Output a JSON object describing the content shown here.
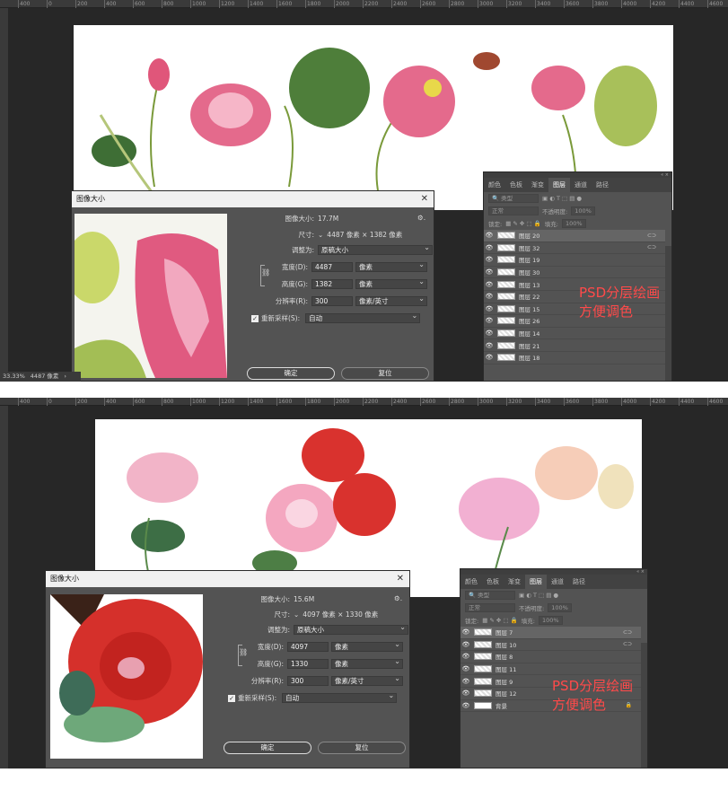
{
  "shots": [
    {
      "ruler_ticks": [
        "400",
        "0",
        "200",
        "400",
        "600",
        "800",
        "1000",
        "1200",
        "1400",
        "1600",
        "1800",
        "2000",
        "2200",
        "2400",
        "2600",
        "2800",
        "3000",
        "3200",
        "3400",
        "3600",
        "3800",
        "4000",
        "4200",
        "4400",
        "4600"
      ],
      "status": {
        "zoom": "33.33%",
        "size": "4487 像素",
        "arrow": "›"
      },
      "dialog": {
        "title": "图像大小",
        "close": "✕",
        "image_size_label": "图像大小:",
        "image_size_value": "17.7M",
        "gear": "⚙.",
        "dimensions_label": "尺寸:",
        "dimensions_value": "4487 像素  ×  1382 像素",
        "fit_label": "调整为:",
        "fit_value": "原稿大小",
        "width_label": "宽度(D):",
        "width_value": "4487",
        "width_unit": "像素",
        "height_label": "高度(G):",
        "height_value": "1382",
        "height_unit": "像素",
        "resolution_label": "分辨率(R):",
        "resolution_value": "300",
        "resolution_unit": "像素/英寸",
        "resample_label": "重新采样(S):",
        "resample_value": "自动",
        "ok": "确定",
        "reset": "复位"
      },
      "panel": {
        "collapse": "« ×",
        "tabs": [
          "颜色",
          "色板",
          "渐变",
          "图层",
          "通道",
          "路径"
        ],
        "active_tab": "图层",
        "filter_placeholder": "类型",
        "blend_mode": "正常",
        "opacity_label": "不透明度:",
        "opacity_value": "100%",
        "lock_label": "锁定:",
        "fill_label": "填充:",
        "fill_value": "100%",
        "layers": [
          "图层 20",
          "图层 32",
          "图层 19",
          "图层 30",
          "图层 13",
          "图层 22",
          "图层 15",
          "图层 26",
          "图层 14",
          "图层 21",
          "图层 18"
        ]
      },
      "overlay": [
        "PSD分层绘画",
        "方便调色"
      ]
    },
    {
      "ruler_ticks": [
        "400",
        "0",
        "200",
        "400",
        "600",
        "800",
        "1000",
        "1200",
        "1400",
        "1600",
        "1800",
        "2000",
        "2200",
        "2400",
        "2600",
        "2800",
        "3000",
        "3200",
        "3400",
        "3600",
        "3800",
        "4000",
        "4200",
        "4400",
        "4600"
      ],
      "dialog": {
        "title": "图像大小",
        "close": "✕",
        "image_size_label": "图像大小:",
        "image_size_value": "15.6M",
        "gear": "⚙.",
        "dimensions_label": "尺寸:",
        "dimensions_value": "4097 像素  ×  1330 像素",
        "fit_label": "调整为:",
        "fit_value": "原稿大小",
        "width_label": "宽度(D):",
        "width_value": "4097",
        "width_unit": "像素",
        "height_label": "高度(G):",
        "height_value": "1330",
        "height_unit": "像素",
        "resolution_label": "分辨率(R):",
        "resolution_value": "300",
        "resolution_unit": "像素/英寸",
        "resample_label": "重新采样(S):",
        "resample_value": "自动",
        "ok": "确定",
        "reset": "复位"
      },
      "panel": {
        "collapse": "« ×",
        "tabs": [
          "颜色",
          "色板",
          "渐变",
          "图层",
          "通道",
          "路径"
        ],
        "active_tab": "图层",
        "filter_placeholder": "类型",
        "blend_mode": "正常",
        "opacity_label": "不透明度:",
        "opacity_value": "100%",
        "lock_label": "锁定:",
        "fill_label": "填充:",
        "fill_value": "100%",
        "layers": [
          "图层 7",
          "图层 10",
          "图层 8",
          "图层 11",
          "图层 9",
          "图层 12",
          "背景"
        ]
      },
      "overlay": [
        "PSD分层绘画",
        "方便调色"
      ]
    }
  ]
}
